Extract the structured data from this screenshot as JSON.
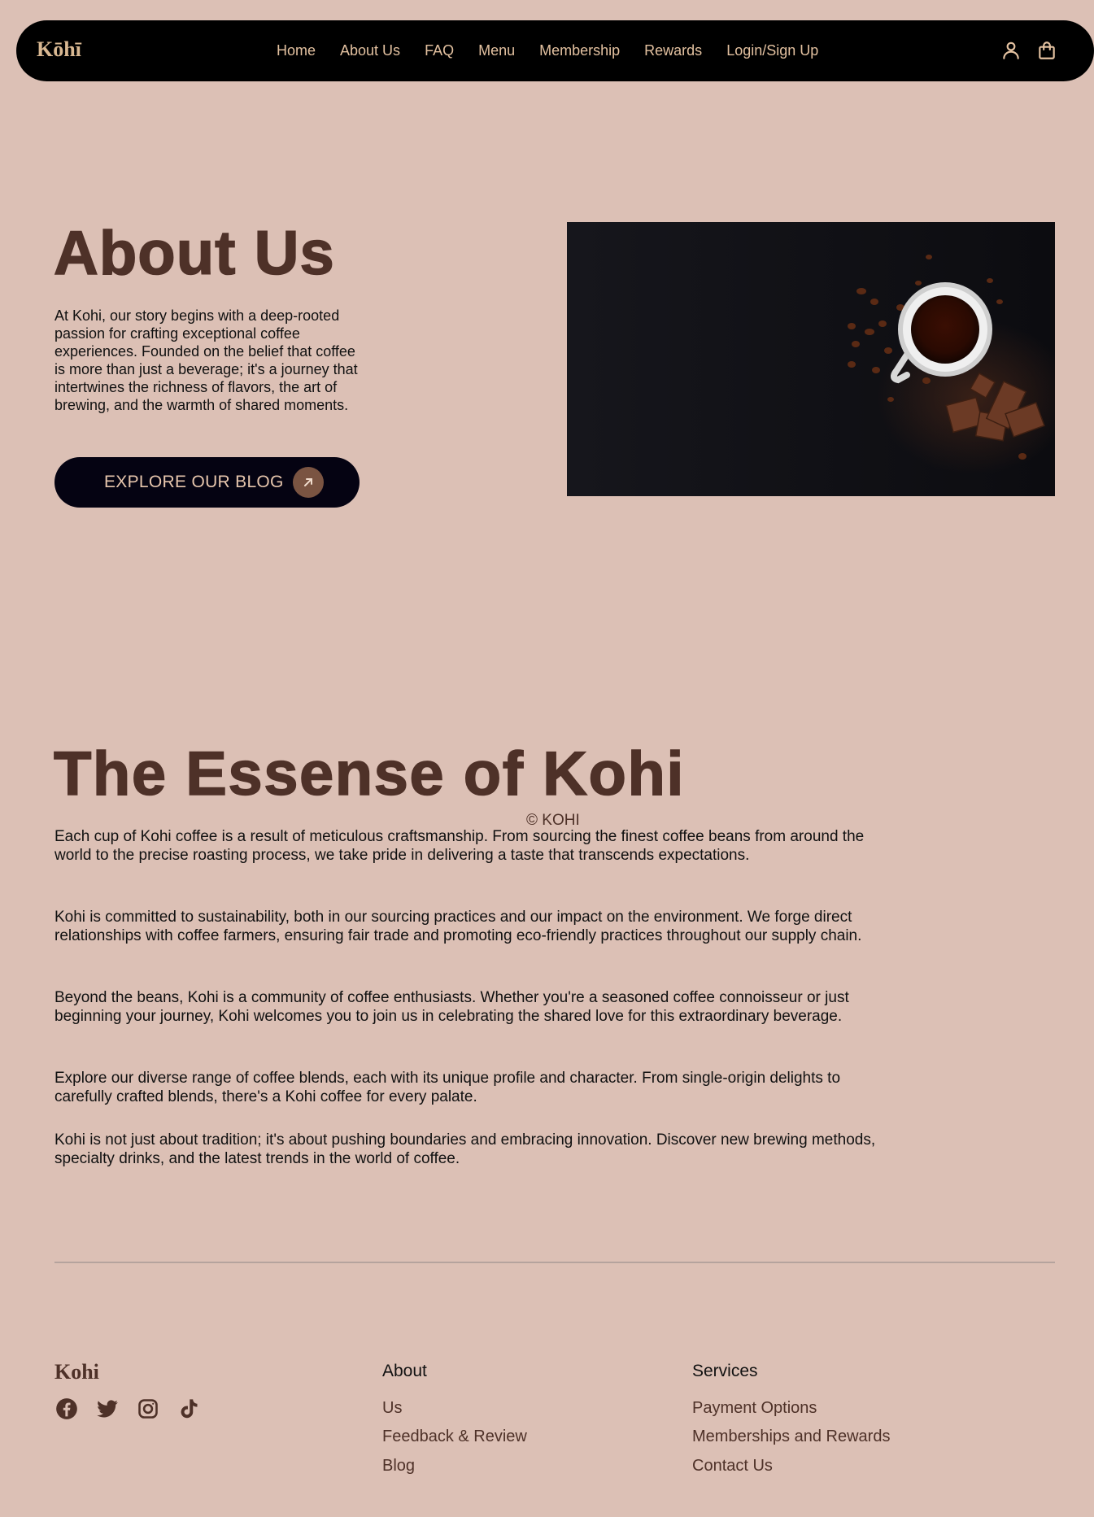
{
  "header": {
    "brand": "Kōhī",
    "nav": [
      "Home",
      "About Us",
      "FAQ",
      "Menu",
      "Membership",
      "Rewards",
      "Login/Sign Up"
    ],
    "icons": [
      "user-icon",
      "shopping-bag-icon"
    ]
  },
  "about": {
    "title": "About Us",
    "text": "At Kohi, our story begins with a deep-rooted passion for crafting exceptional coffee experiences. Founded on the belief that coffee is more than just a beverage; it's a journey that intertwines the richness of flavors, the art of brewing, and the warmth of shared moments.",
    "button_label": "EXPLORE OUR BLOG",
    "button_icon": "arrow-up-right-icon",
    "image": "coffee-cup-with-beans-and-chocolate"
  },
  "essense": {
    "title": "The Essense of Kohi",
    "paragraphs": [
      "Each cup of Kohi coffee is a result of meticulous craftsmanship. From sourcing the finest coffee beans from around the world to the precise roasting process, we take pride in delivering a taste that transcends expectations.",
      "Kohi is committed to sustainability, both in our sourcing practices and our impact on the environment. We forge direct relationships with coffee farmers, ensuring fair trade and promoting eco-friendly practices throughout our supply chain.",
      "Beyond the beans, Kohi is a community of coffee enthusiasts. Whether you're a seasoned coffee connoisseur or just beginning your journey, Kohi welcomes you to join us in celebrating the shared love for this extraordinary beverage.",
      "Explore our diverse range of coffee blends, each with its unique profile and character. From single-origin delights to carefully crafted blends, there's a Kohi coffee for every palate.",
      "Kohi is not just about tradition; it's about pushing boundaries and embracing innovation. Discover new brewing methods, specialty drinks, and the latest trends in the world of coffee."
    ]
  },
  "copyright": "© KOHI",
  "footer": {
    "brand": "Kohi",
    "social": [
      "facebook-icon",
      "twitter-icon",
      "instagram-icon",
      "tiktok-icon"
    ],
    "about": {
      "heading": "About",
      "links": [
        "Us",
        "Feedback & Review",
        "Blog"
      ]
    },
    "services": {
      "heading": "Services",
      "links": [
        "Payment Options",
        "Memberships and Rewards",
        "Contact Us"
      ]
    }
  },
  "colors": {
    "background": "#dcc0b5",
    "brown": "#4e3128",
    "nav_text": "#e3c1a0",
    "navbar_bg": "#000000"
  }
}
